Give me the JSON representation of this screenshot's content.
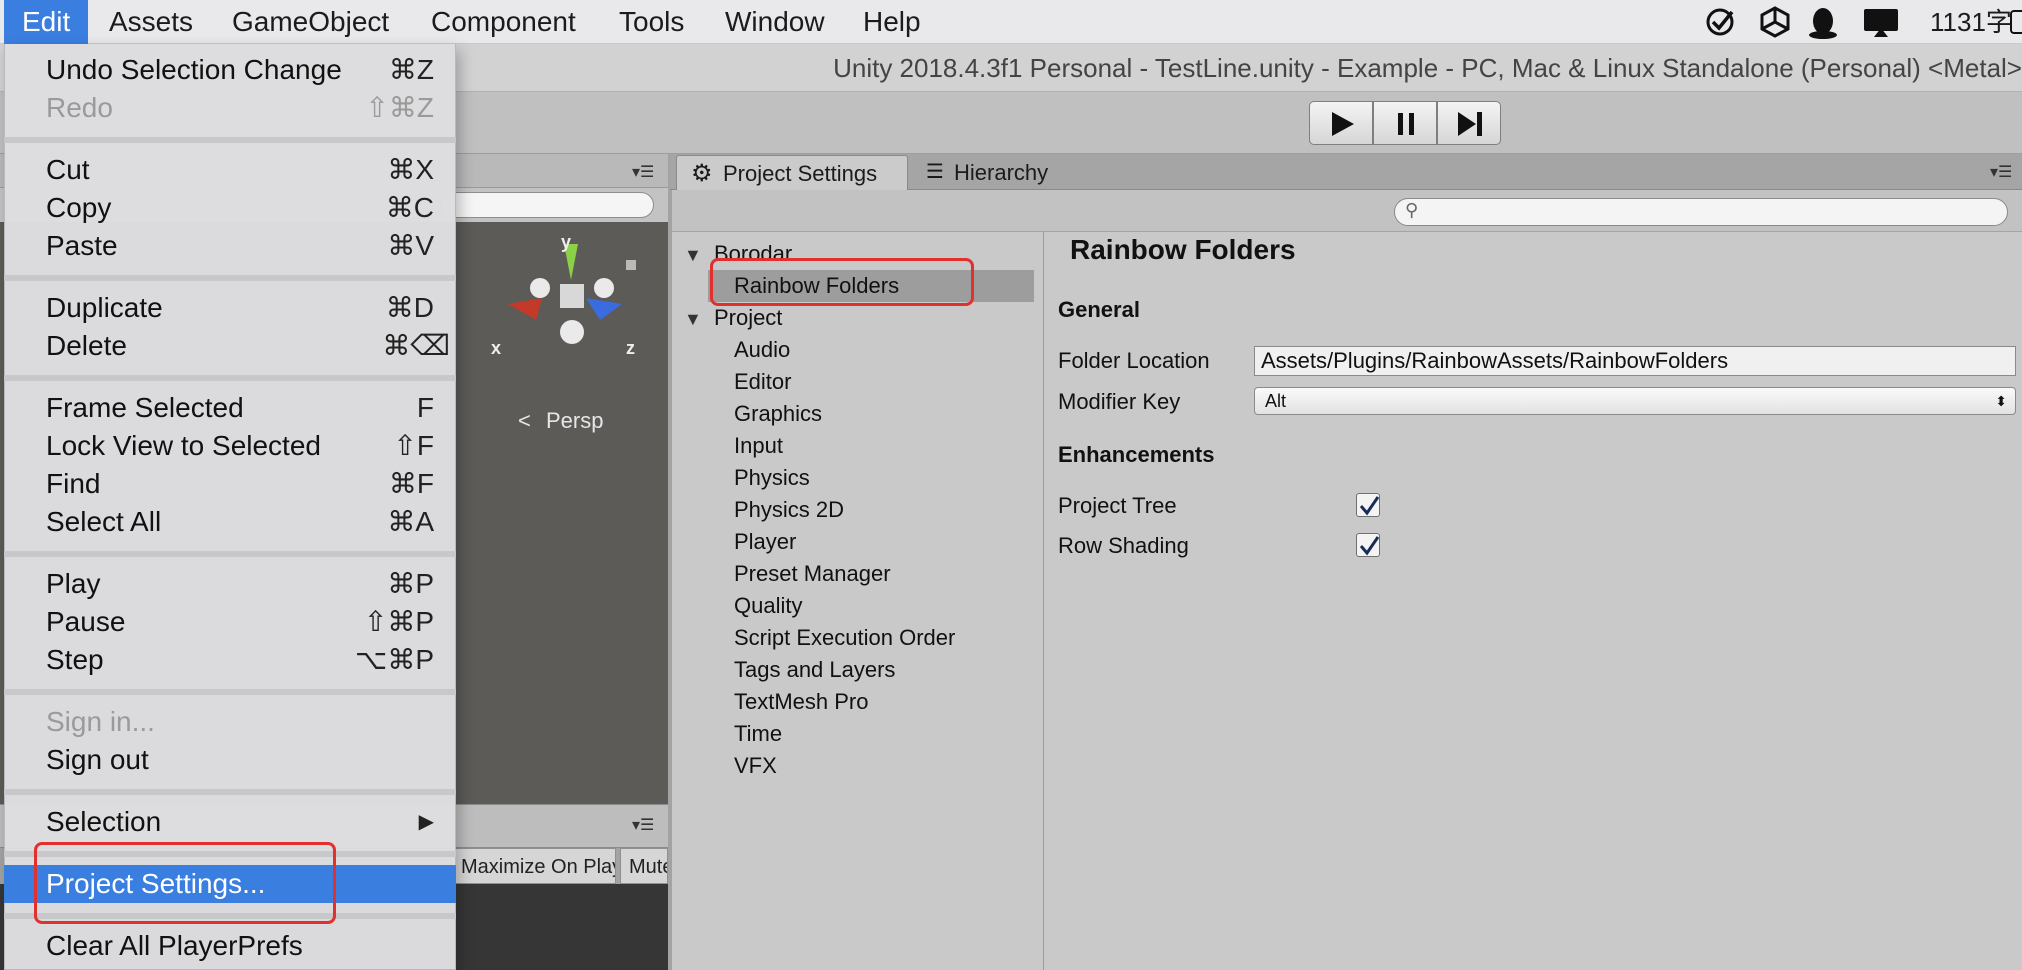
{
  "menubar": {
    "items": [
      "Edit",
      "Assets",
      "GameObject",
      "Component",
      "Tools",
      "Window",
      "Help"
    ],
    "status_text": "1131字"
  },
  "window": {
    "title": "Unity 2018.4.3f1 Personal - TestLine.unity - Example - PC, Mac & Linux Standalone (Personal) <Metal>"
  },
  "scene": {
    "gizmo_labels": {
      "y": "y",
      "x": "x",
      "z": "z"
    },
    "persp_label": "Persp"
  },
  "game_toolbar": {
    "maximize_label": "Maximize On Play",
    "mute_label": "Mute"
  },
  "edit_menu": {
    "undo": {
      "label": "Undo Selection Change",
      "shortcut": "⌘Z"
    },
    "redo": {
      "label": "Redo",
      "shortcut": "⇧⌘Z"
    },
    "cut": {
      "label": "Cut",
      "shortcut": "⌘X"
    },
    "copy": {
      "label": "Copy",
      "shortcut": "⌘C"
    },
    "paste": {
      "label": "Paste",
      "shortcut": "⌘V"
    },
    "duplicate": {
      "label": "Duplicate",
      "shortcut": "⌘D"
    },
    "delete": {
      "label": "Delete",
      "shortcut": "⌘⌫"
    },
    "frame_selected": {
      "label": "Frame Selected",
      "shortcut": "F"
    },
    "lock_view": {
      "label": "Lock View to Selected",
      "shortcut": "⇧F"
    },
    "find": {
      "label": "Find",
      "shortcut": "⌘F"
    },
    "select_all": {
      "label": "Select All",
      "shortcut": "⌘A"
    },
    "play": {
      "label": "Play",
      "shortcut": "⌘P"
    },
    "pause": {
      "label": "Pause",
      "shortcut": "⇧⌘P"
    },
    "step": {
      "label": "Step",
      "shortcut": "⌥⌘P"
    },
    "sign_in": {
      "label": "Sign in..."
    },
    "sign_out": {
      "label": "Sign out"
    },
    "selection": {
      "label": "Selection",
      "shortcut": "▶"
    },
    "project_settings": {
      "label": "Project Settings..."
    },
    "clear_prefs": {
      "label": "Clear All PlayerPrefs"
    }
  },
  "tabs": {
    "project_settings": "Project Settings",
    "hierarchy": "Hierarchy"
  },
  "settings_tree": {
    "borodar": "Borodar",
    "rainbow_folders": "Rainbow Folders",
    "project": "Project",
    "items": [
      "Audio",
      "Editor",
      "Graphics",
      "Input",
      "Physics",
      "Physics 2D",
      "Player",
      "Preset Manager",
      "Quality",
      "Script Execution Order",
      "Tags and Layers",
      "TextMesh Pro",
      "Time",
      "VFX"
    ]
  },
  "settings_panel": {
    "title": "Rainbow Folders",
    "general": "General",
    "folder_location_label": "Folder Location",
    "folder_location_value": "Assets/Plugins/RainbowAssets/RainbowFolders",
    "modifier_key_label": "Modifier Key",
    "modifier_key_value": "Alt",
    "enhancements": "Enhancements",
    "project_tree_label": "Project Tree",
    "project_tree_checked": true,
    "row_shading_label": "Row Shading",
    "row_shading_checked": true
  },
  "colors": {
    "menu_highlight": "#3a7ee0",
    "annotation_red": "#e0312f"
  }
}
